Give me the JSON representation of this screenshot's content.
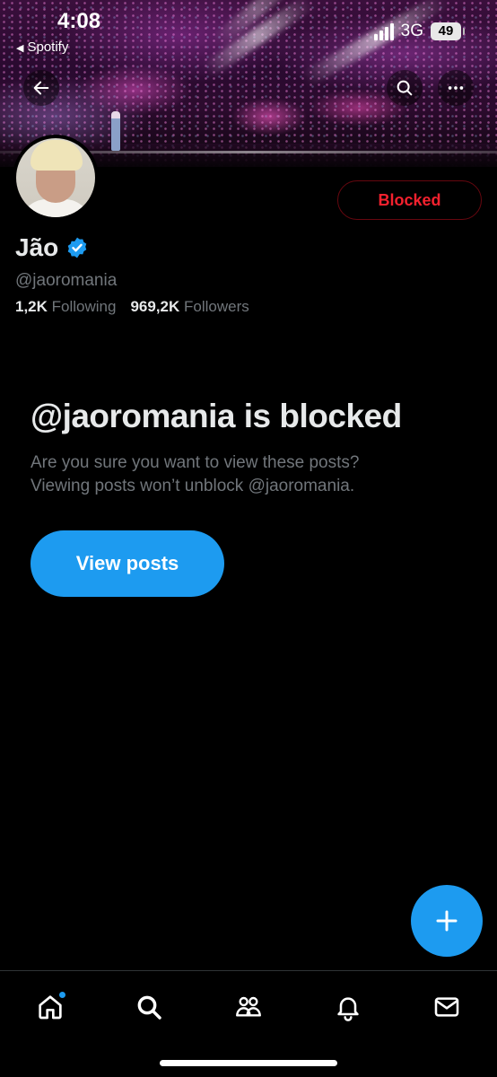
{
  "status_bar": {
    "time": "4:08",
    "back_app": "Spotify",
    "network": "3G",
    "battery": "49"
  },
  "profile": {
    "name": "Jão",
    "handle": "@jaoromania",
    "verified": true,
    "following_count": "1,2K",
    "following_label": "Following",
    "followers_count": "969,2K",
    "followers_label": "Followers",
    "blocked_label": "Blocked"
  },
  "blocked_notice": {
    "title": "@jaoromania is blocked",
    "line1": "Are you sure you want to view these posts?",
    "line2": "Viewing posts won’t unblock @jaoromania.",
    "view_posts_label": "View posts"
  },
  "colors": {
    "accent": "#1d9bf0",
    "danger": "#f4212e",
    "muted_text": "#71767b",
    "primary_text": "#e7e9ea",
    "background": "#000000"
  },
  "icons": {
    "back": "arrow-left-icon",
    "search": "search-icon",
    "more": "more-horizontal-icon",
    "verified": "verified-badge-icon",
    "compose": "plus-icon",
    "tabs": [
      "home-icon",
      "search-icon",
      "communities-icon",
      "notifications-icon",
      "messages-icon"
    ]
  }
}
